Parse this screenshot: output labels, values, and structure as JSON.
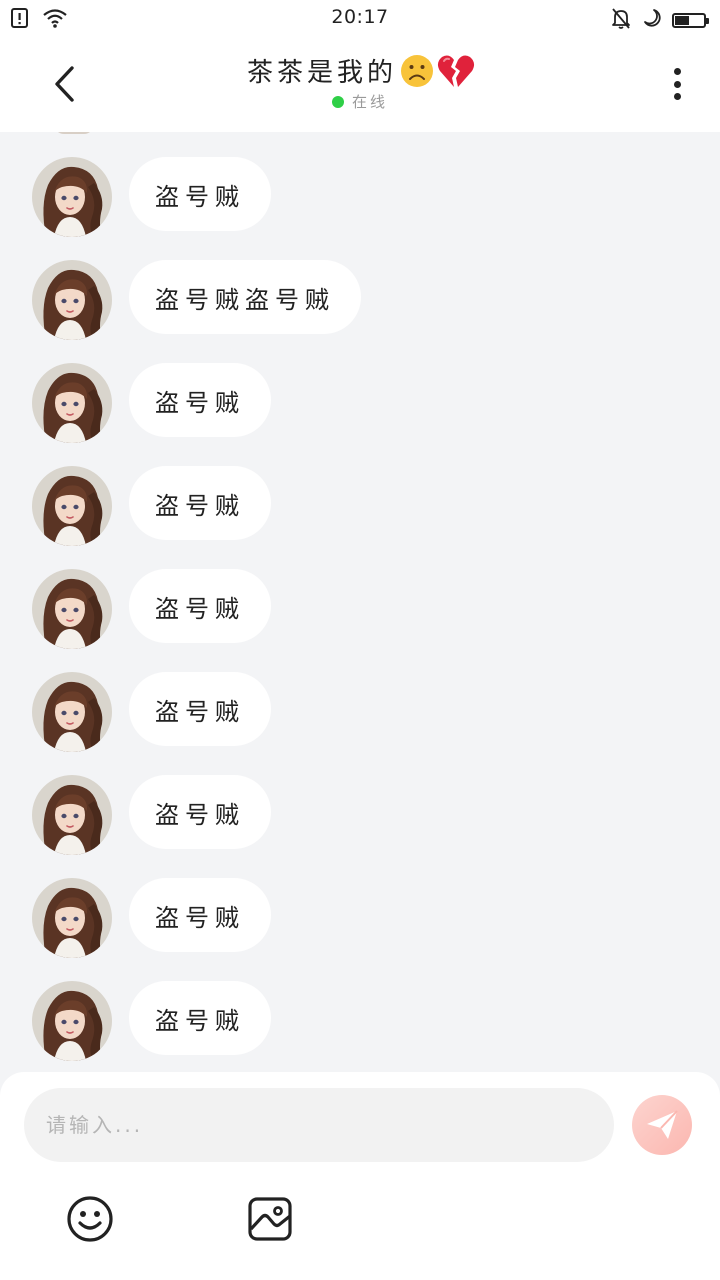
{
  "status_bar": {
    "time": "20:17",
    "battery_level": 0.45,
    "icons_left": [
      "sim-alert-icon",
      "wifi-icon"
    ],
    "icons_right": [
      "muted-bell-icon",
      "moon-icon",
      "battery-icon"
    ]
  },
  "header": {
    "title": "茶茶是我的",
    "title_emojis": [
      "frowning-face-icon",
      "broken-heart-icon"
    ],
    "status": "在线",
    "status_color": "#2fcf47"
  },
  "messages": [
    {
      "sender": "other",
      "text": "盗号贼"
    },
    {
      "sender": "other",
      "text": "盗号贼盗号贼"
    },
    {
      "sender": "other",
      "text": "盗号贼"
    },
    {
      "sender": "other",
      "text": "盗号贼"
    },
    {
      "sender": "other",
      "text": "盗号贼"
    },
    {
      "sender": "other",
      "text": "盗号贼"
    },
    {
      "sender": "other",
      "text": "盗号贼"
    },
    {
      "sender": "other",
      "text": "盗号贼"
    },
    {
      "sender": "other",
      "text": "盗号贼"
    }
  ],
  "composer": {
    "placeholder": "请输入...",
    "send_icon": "paper-plane-icon",
    "tools": [
      "smiley-icon",
      "image-icon"
    ]
  },
  "colors": {
    "background": "#f3f4f6",
    "bubble": "#ffffff",
    "send_button": "#fbb7b0"
  }
}
